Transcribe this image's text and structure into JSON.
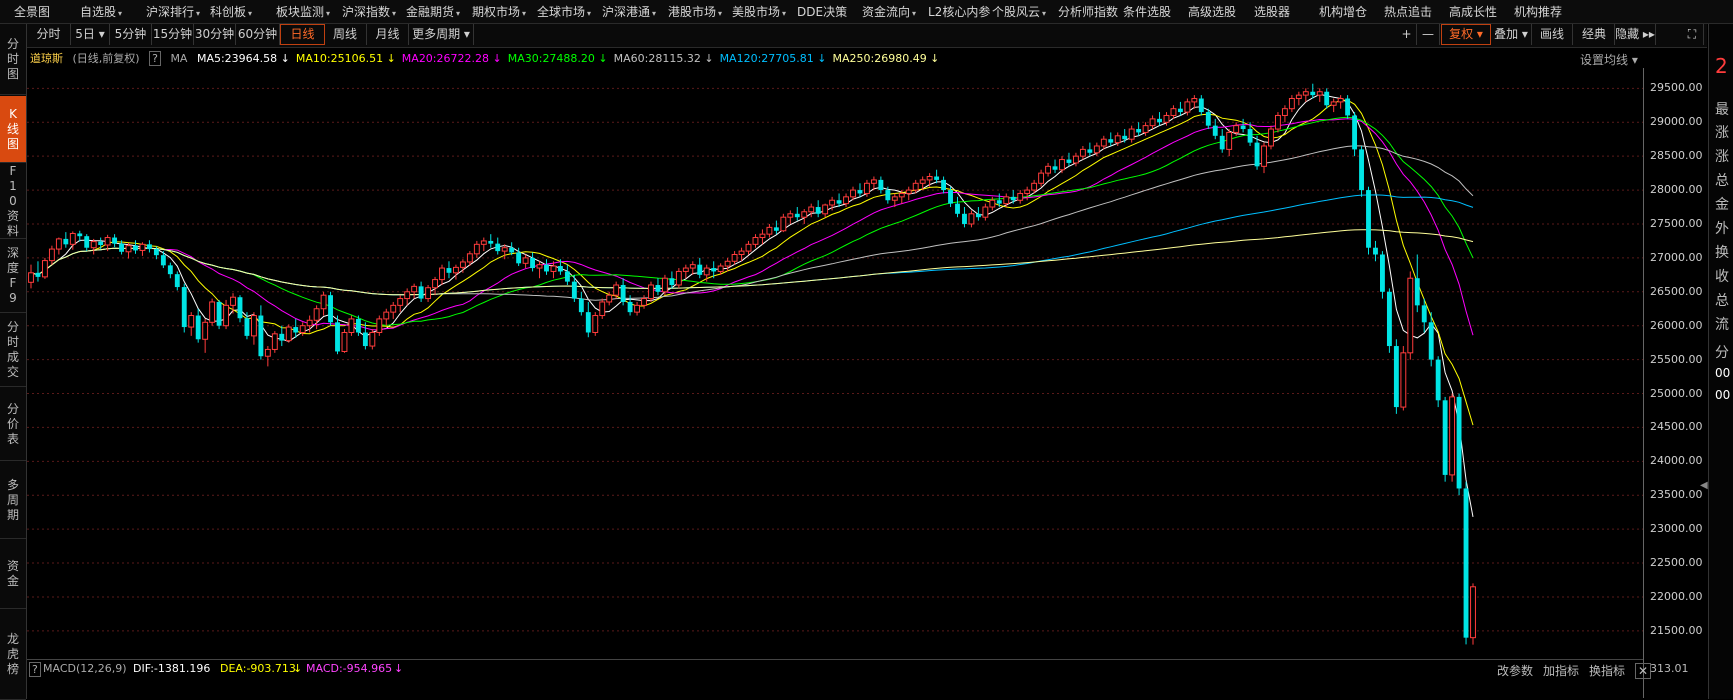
{
  "menu": [
    {
      "label": "全景图",
      "caret": false
    },
    {
      "label": "自选股",
      "caret": true
    },
    {
      "label": "沪深排行",
      "caret": true
    },
    {
      "label": "科创板",
      "caret": true
    },
    {
      "label": "板块监测",
      "caret": true
    },
    {
      "label": "沪深指数",
      "caret": true
    },
    {
      "label": "金融期货",
      "caret": true
    },
    {
      "label": "期权市场",
      "caret": true
    },
    {
      "label": "全球市场",
      "caret": true
    },
    {
      "label": "沪深港通",
      "caret": true
    },
    {
      "label": "港股市场",
      "caret": true
    },
    {
      "label": "美股市场",
      "caret": true
    },
    {
      "label": "DDE决策",
      "caret": false
    },
    {
      "label": "资金流向",
      "caret": true
    },
    {
      "label": "L2核心内参",
      "caret": false
    },
    {
      "label": "个股风云",
      "caret": true
    },
    {
      "label": "分析师指数",
      "caret": false
    },
    {
      "label": "条件选股",
      "caret": false
    },
    {
      "label": "高级选股",
      "caret": false
    },
    {
      "label": "选股器",
      "caret": false
    },
    {
      "label": "机构增仓",
      "caret": false
    },
    {
      "label": "热点追击",
      "caret": false
    },
    {
      "label": "高成长性",
      "caret": false
    },
    {
      "label": "机构推荐",
      "caret": false
    }
  ],
  "toolbar": {
    "periods": [
      "分时",
      "5日 ▾",
      "5分钟",
      "15分钟",
      "30分钟",
      "60分钟",
      "日线",
      "周线",
      "月线",
      "更多周期 ▾"
    ],
    "active_period": "日线",
    "right": [
      "+",
      "—",
      "复权 ▾",
      "叠加 ▾",
      "画线",
      "经典",
      "隐藏 ▸▸",
      "⛶"
    ]
  },
  "left_tabs": [
    {
      "label": "分时图",
      "active": false
    },
    {
      "label": "K线图",
      "active": true
    },
    {
      "label": "F10资料",
      "active": false
    },
    {
      "label": "深度F9",
      "active": false
    },
    {
      "label": "分时成交",
      "active": false
    },
    {
      "label": "分价表",
      "active": false
    },
    {
      "label": "多周期",
      "active": false
    },
    {
      "label": "资金",
      "active": false
    },
    {
      "label": "龙虎榜",
      "active": false
    }
  ],
  "right_panel": [
    "2",
    "最",
    "涨",
    "涨",
    "总",
    "金",
    "外",
    "换",
    "收",
    "总",
    "流",
    "分",
    "00",
    "00"
  ],
  "legend": {
    "name": "道琼斯",
    "mode": "(日线,前复权)",
    "help": "?",
    "ma_label": "MA",
    "items": [
      {
        "text": "MA5:23964.58",
        "arrow": "↓",
        "color": "#ffffff"
      },
      {
        "text": "MA10:25106.51",
        "arrow": "↓",
        "color": "#ffff00"
      },
      {
        "text": "MA20:26722.28",
        "arrow": "↓",
        "color": "#ff00ff"
      },
      {
        "text": "MA30:27488.20",
        "arrow": "↓",
        "color": "#00ff00"
      },
      {
        "text": "MA60:28115.32",
        "arrow": "↓",
        "color": "#c0c0c0"
      },
      {
        "text": "MA120:27705.81",
        "arrow": "↓",
        "color": "#00bfff"
      },
      {
        "text": "MA250:26980.49",
        "arrow": "↓",
        "color": "#ffff99"
      }
    ],
    "settings": "设置均线 ▾"
  },
  "macd": {
    "help": "?",
    "title": "MACD(12,26,9)",
    "dif": "DIF:-1381.196",
    "dea": "DEA:-903.713",
    "macd": "MACD:-954.965",
    "actions": [
      "改参数",
      "加指标",
      "换指标"
    ],
    "close": "✕",
    "axis_value": "313.01"
  },
  "colors": {
    "up": "#ff3c3c",
    "down": "#00e5e5",
    "bg": "#000000",
    "grid": "#5a1a1a"
  },
  "chart_data": {
    "type": "candlestick",
    "title": "道琼斯",
    "ylim": [
      21100,
      29800
    ],
    "yticks": [
      21500,
      22000,
      22500,
      23000,
      23500,
      24000,
      24500,
      25000,
      25500,
      26000,
      26500,
      27000,
      27500,
      28000,
      28500,
      29000,
      29500
    ],
    "annotations": [
      {
        "label": "29568.57",
        "index": 250,
        "value": 29568.57
      },
      {
        "label": "21297.88",
        "index": 299,
        "value": 21297.88
      }
    ],
    "ohlc": [
      [
        26640,
        26900,
        26550,
        26780
      ],
      [
        26780,
        26950,
        26650,
        26720
      ],
      [
        26720,
        27000,
        26690,
        26960
      ],
      [
        26960,
        27180,
        26900,
        27130
      ],
      [
        27130,
        27300,
        27050,
        27280
      ],
      [
        27280,
        27380,
        27150,
        27200
      ],
      [
        27200,
        27390,
        27120,
        27360
      ],
      [
        27360,
        27400,
        27240,
        27320
      ],
      [
        27320,
        27350,
        27100,
        27150
      ],
      [
        27150,
        27280,
        27050,
        27240
      ],
      [
        27240,
        27300,
        27130,
        27190
      ],
      [
        27190,
        27340,
        27100,
        27300
      ],
      [
        27300,
        27350,
        27160,
        27210
      ],
      [
        27210,
        27260,
        27050,
        27090
      ],
      [
        27090,
        27220,
        26990,
        27180
      ],
      [
        27180,
        27260,
        27060,
        27110
      ],
      [
        27110,
        27230,
        27030,
        27200
      ],
      [
        27200,
        27260,
        27080,
        27130
      ],
      [
        27130,
        27170,
        26980,
        27040
      ],
      [
        27040,
        27100,
        26850,
        26890
      ],
      [
        26890,
        26930,
        26700,
        26760
      ],
      [
        26760,
        26800,
        26520,
        26570
      ],
      [
        26570,
        26620,
        25900,
        25980
      ],
      [
        25980,
        26200,
        25850,
        26150
      ],
      [
        26150,
        26250,
        25750,
        25800
      ],
      [
        25800,
        26100,
        25600,
        26050
      ],
      [
        26050,
        26400,
        26000,
        26350
      ],
      [
        26350,
        26380,
        25950,
        26000
      ],
      [
        26000,
        26380,
        25950,
        26300
      ],
      [
        26300,
        26480,
        26180,
        26420
      ],
      [
        26420,
        26450,
        26050,
        26110
      ],
      [
        26110,
        26200,
        25800,
        25850
      ],
      [
        25850,
        26200,
        25720,
        26150
      ],
      [
        26150,
        26300,
        25500,
        25550
      ],
      [
        25550,
        25700,
        25400,
        25650
      ],
      [
        25650,
        25920,
        25600,
        25880
      ],
      [
        25880,
        26000,
        25700,
        25780
      ],
      [
        25780,
        26020,
        25750,
        25980
      ],
      [
        25980,
        26100,
        25820,
        25900
      ],
      [
        25900,
        26050,
        25850,
        26000
      ],
      [
        26000,
        26150,
        25900,
        26080
      ],
      [
        26080,
        26300,
        25950,
        26250
      ],
      [
        26250,
        26500,
        26150,
        26450
      ],
      [
        26450,
        26500,
        26000,
        26050
      ],
      [
        26050,
        26150,
        25580,
        25620
      ],
      [
        25620,
        25950,
        25600,
        25900
      ],
      [
        25900,
        26150,
        25850,
        26100
      ],
      [
        26100,
        26150,
        25850,
        25900
      ],
      [
        25900,
        26050,
        25650,
        25700
      ],
      [
        25700,
        25950,
        25650,
        25900
      ],
      [
        25900,
        26150,
        25850,
        26100
      ],
      [
        26100,
        26250,
        26000,
        26200
      ],
      [
        26200,
        26350,
        26100,
        26300
      ],
      [
        26300,
        26450,
        26200,
        26400
      ],
      [
        26400,
        26550,
        26300,
        26500
      ],
      [
        26500,
        26620,
        26400,
        26580
      ],
      [
        26580,
        26650,
        26350,
        26400
      ],
      [
        26400,
        26600,
        26350,
        26560
      ],
      [
        26560,
        26720,
        26450,
        26680
      ],
      [
        26680,
        26900,
        26600,
        26850
      ],
      [
        26850,
        26950,
        26700,
        26780
      ],
      [
        26780,
        26900,
        26680,
        26860
      ],
      [
        26860,
        26980,
        26780,
        26940
      ],
      [
        26940,
        27100,
        26880,
        27060
      ],
      [
        27060,
        27250,
        27000,
        27200
      ],
      [
        27200,
        27300,
        27100,
        27250
      ],
      [
        27250,
        27350,
        27150,
        27210
      ],
      [
        27210,
        27300,
        27050,
        27100
      ],
      [
        27100,
        27200,
        26980,
        27150
      ],
      [
        27150,
        27230,
        27040,
        27080
      ],
      [
        27080,
        27150,
        26880,
        26920
      ],
      [
        26920,
        27050,
        26850,
        27000
      ],
      [
        27000,
        27080,
        26800,
        26850
      ],
      [
        26850,
        26950,
        26700,
        26900
      ],
      [
        26900,
        26980,
        26750,
        26800
      ],
      [
        26800,
        26950,
        26700,
        26880
      ],
      [
        26880,
        26980,
        26750,
        26800
      ],
      [
        26800,
        26900,
        26600,
        26650
      ],
      [
        26650,
        26750,
        26350,
        26400
      ],
      [
        26400,
        26500,
        26150,
        26200
      ],
      [
        26200,
        26350,
        25830,
        25900
      ],
      [
        25900,
        26200,
        25850,
        26150
      ],
      [
        26150,
        26400,
        26100,
        26350
      ],
      [
        26350,
        26500,
        26300,
        26450
      ],
      [
        26450,
        26650,
        26400,
        26600
      ],
      [
        26600,
        26700,
        26300,
        26350
      ],
      [
        26350,
        26450,
        26150,
        26200
      ],
      [
        26200,
        26350,
        26150,
        26300
      ],
      [
        26300,
        26450,
        26250,
        26400
      ],
      [
        26400,
        26650,
        26350,
        26600
      ],
      [
        26600,
        26700,
        26450,
        26500
      ],
      [
        26500,
        26750,
        26450,
        26700
      ],
      [
        26700,
        26800,
        26550,
        26600
      ],
      [
        26600,
        26850,
        26550,
        26800
      ],
      [
        26800,
        26900,
        26700,
        26850
      ],
      [
        26850,
        26950,
        26750,
        26900
      ],
      [
        26900,
        27000,
        26700,
        26750
      ],
      [
        26750,
        26900,
        26650,
        26850
      ],
      [
        26850,
        26950,
        26700,
        26800
      ],
      [
        26800,
        26920,
        26750,
        26880
      ],
      [
        26880,
        27000,
        26800,
        26950
      ],
      [
        26950,
        27100,
        26900,
        27050
      ],
      [
        27050,
        27150,
        26950,
        27100
      ],
      [
        27100,
        27250,
        27050,
        27200
      ],
      [
        27200,
        27350,
        27150,
        27300
      ],
      [
        27300,
        27420,
        27200,
        27350
      ],
      [
        27350,
        27500,
        27300,
        27450
      ],
      [
        27450,
        27550,
        27350,
        27400
      ],
      [
        27400,
        27650,
        27380,
        27600
      ],
      [
        27600,
        27700,
        27500,
        27650
      ],
      [
        27650,
        27750,
        27550,
        27600
      ],
      [
        27600,
        27720,
        27500,
        27680
      ],
      [
        27680,
        27800,
        27600,
        27750
      ],
      [
        27750,
        27850,
        27600,
        27650
      ],
      [
        27650,
        27800,
        27600,
        27780
      ],
      [
        27780,
        27900,
        27700,
        27850
      ],
      [
        27850,
        27950,
        27750,
        27800
      ],
      [
        27800,
        27950,
        27750,
        27900
      ],
      [
        27900,
        28050,
        27850,
        28000
      ],
      [
        28000,
        28100,
        27900,
        27950
      ],
      [
        27950,
        28150,
        27900,
        28100
      ],
      [
        28100,
        28200,
        28000,
        28150
      ],
      [
        28150,
        28200,
        27950,
        28000
      ],
      [
        28000,
        28050,
        27800,
        27850
      ],
      [
        27850,
        27950,
        27750,
        27900
      ],
      [
        27900,
        28000,
        27800,
        27950
      ],
      [
        27950,
        28050,
        27850,
        28000
      ],
      [
        28000,
        28150,
        27950,
        28100
      ],
      [
        28100,
        28200,
        28000,
        28150
      ],
      [
        28150,
        28250,
        28050,
        28200
      ],
      [
        28200,
        28300,
        28100,
        28150
      ],
      [
        28150,
        28200,
        27950,
        28000
      ],
      [
        28000,
        28050,
        27750,
        27800
      ],
      [
        27800,
        27900,
        27600,
        27650
      ],
      [
        27650,
        27750,
        27450,
        27500
      ],
      [
        27500,
        27700,
        27450,
        27650
      ],
      [
        27650,
        27750,
        27550,
        27600
      ],
      [
        27600,
        27800,
        27550,
        27750
      ],
      [
        27750,
        27900,
        27700,
        27850
      ],
      [
        27850,
        27950,
        27750,
        27800
      ],
      [
        27800,
        27950,
        27750,
        27900
      ],
      [
        27900,
        28000,
        27800,
        27850
      ],
      [
        27850,
        28000,
        27800,
        27950
      ],
      [
        27950,
        28050,
        27850,
        28000
      ],
      [
        28000,
        28150,
        27950,
        28100
      ],
      [
        28100,
        28300,
        28050,
        28250
      ],
      [
        28250,
        28400,
        28200,
        28350
      ],
      [
        28350,
        28450,
        28250,
        28300
      ],
      [
        28300,
        28500,
        28250,
        28450
      ],
      [
        28450,
        28550,
        28350,
        28400
      ],
      [
        28400,
        28550,
        28350,
        28500
      ],
      [
        28500,
        28650,
        28450,
        28600
      ],
      [
        28600,
        28700,
        28500,
        28550
      ],
      [
        28550,
        28700,
        28500,
        28650
      ],
      [
        28650,
        28800,
        28600,
        28750
      ],
      [
        28750,
        28850,
        28650,
        28700
      ],
      [
        28700,
        28850,
        28650,
        28800
      ],
      [
        28800,
        28900,
        28700,
        28750
      ],
      [
        28750,
        28950,
        28700,
        28900
      ],
      [
        28900,
        29000,
        28800,
        28850
      ],
      [
        28850,
        29000,
        28800,
        28950
      ],
      [
        28950,
        29100,
        28900,
        29050
      ],
      [
        29050,
        29150,
        28950,
        29000
      ],
      [
        29000,
        29150,
        28950,
        29100
      ],
      [
        29100,
        29250,
        29050,
        29200
      ],
      [
        29200,
        29300,
        29100,
        29150
      ],
      [
        29150,
        29350,
        29100,
        29300
      ],
      [
        29300,
        29400,
        29200,
        29350
      ],
      [
        29350,
        29400,
        29100,
        29150
      ],
      [
        29150,
        29200,
        28900,
        28950
      ],
      [
        28950,
        29050,
        28750,
        28800
      ],
      [
        28800,
        28900,
        28550,
        28600
      ],
      [
        28600,
        28900,
        28500,
        28850
      ],
      [
        28850,
        29000,
        28800,
        28950
      ],
      [
        28950,
        29050,
        28850,
        28900
      ],
      [
        28900,
        29000,
        28650,
        28700
      ],
      [
        28700,
        28800,
        28300,
        28350
      ],
      [
        28350,
        28700,
        28250,
        28650
      ],
      [
        28650,
        28950,
        28600,
        28900
      ],
      [
        28900,
        29150,
        28850,
        29100
      ],
      [
        29100,
        29250,
        29000,
        29200
      ],
      [
        29200,
        29400,
        29150,
        29350
      ],
      [
        29350,
        29450,
        29250,
        29400
      ],
      [
        29400,
        29500,
        29300,
        29450
      ],
      [
        29450,
        29568.57,
        29350,
        29400
      ],
      [
        29400,
        29500,
        29300,
        29450
      ],
      [
        29450,
        29500,
        29200,
        29250
      ],
      [
        29250,
        29350,
        29150,
        29300
      ],
      [
        29300,
        29400,
        29200,
        29350
      ],
      [
        29350,
        29400,
        29050,
        29100
      ],
      [
        29100,
        29150,
        28500,
        28600
      ],
      [
        28600,
        28650,
        27900,
        28000
      ],
      [
        28000,
        28050,
        27050,
        27150
      ],
      [
        27150,
        27250,
        26950,
        27050
      ],
      [
        27050,
        27100,
        26400,
        26500
      ],
      [
        26500,
        26550,
        25600,
        25700
      ],
      [
        25700,
        25800,
        24700,
        24800
      ],
      [
        24800,
        25700,
        24750,
        25600
      ],
      [
        25600,
        26800,
        25500,
        26700
      ],
      [
        26700,
        27050,
        26200,
        26300
      ],
      [
        26300,
        26400,
        25900,
        26050
      ],
      [
        26050,
        26200,
        25400,
        25500
      ],
      [
        25500,
        25550,
        24800,
        24900
      ],
      [
        24900,
        24950,
        23700,
        23800
      ],
      [
        23800,
        25000,
        23700,
        24950
      ],
      [
        24950,
        25000,
        23500,
        23600
      ],
      [
        23600,
        23700,
        21300,
        21400
      ],
      [
        21400,
        22200,
        21297.88,
        22150
      ]
    ]
  }
}
